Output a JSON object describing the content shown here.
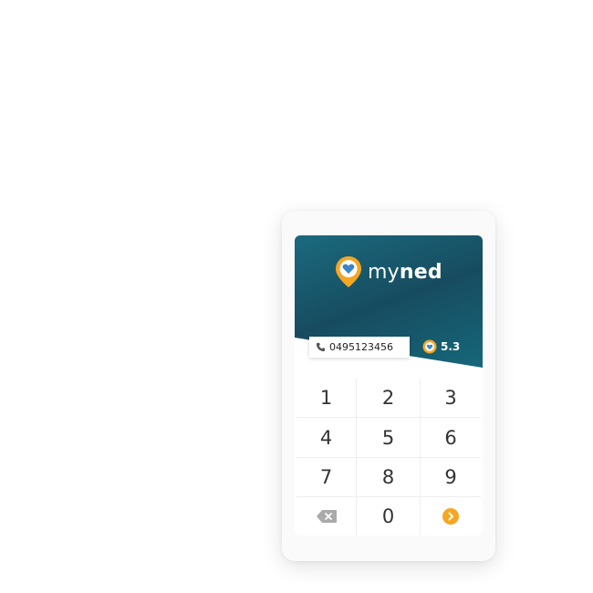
{
  "app": {
    "brand_light": "my",
    "brand_bold": "ned"
  },
  "phone": {
    "icon": "phone-icon",
    "value": "0495123456"
  },
  "points": {
    "icon": "heart-pin-icon",
    "value": "5.3"
  },
  "keypad": {
    "keys": [
      "1",
      "2",
      "3",
      "4",
      "5",
      "6",
      "7",
      "8",
      "9"
    ],
    "zero": "0",
    "backspace_icon": "backspace-icon",
    "enter_icon": "chevron-right-icon"
  },
  "colors": {
    "header_dark": "#174c60",
    "header_teal": "#1b6a7e",
    "accent_orange": "#f5a623",
    "heart_blue": "#3a86c8"
  }
}
